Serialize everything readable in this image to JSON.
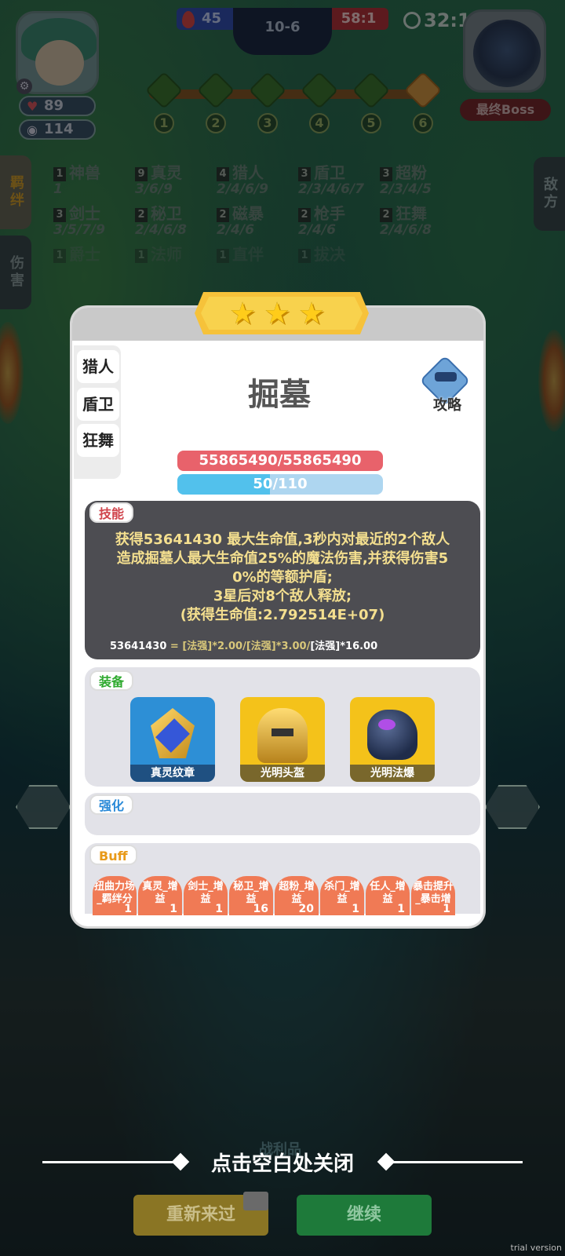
{
  "hud": {
    "blue_score": "45",
    "stage": "10-6",
    "red_score": "58:1",
    "timer": "32:1",
    "hp": "89",
    "coins": "114",
    "boss_label": "最终Boss",
    "nodes": [
      "1",
      "2",
      "3",
      "4",
      "5",
      "6"
    ]
  },
  "sidebar": {
    "tab_synergy": "羁绊",
    "tab_damage": "伤害",
    "tab_enemy": "敌方"
  },
  "synergies": [
    {
      "count": "1",
      "name": "神兽",
      "levels": "1"
    },
    {
      "count": "9",
      "name": "真灵",
      "levels": "3/6/9"
    },
    {
      "count": "4",
      "name": "猎人",
      "levels": "2/4/6/9"
    },
    {
      "count": "3",
      "name": "盾卫",
      "levels": "2/3/4/6/7"
    },
    {
      "count": "3",
      "name": "超粉",
      "levels": "2/3/4/5"
    },
    {
      "count": "3",
      "name": "剑士",
      "levels": "3/5/7/9"
    },
    {
      "count": "2",
      "name": "秘卫",
      "levels": "2/4/6/8"
    },
    {
      "count": "2",
      "name": "磁暴",
      "levels": "2/4/6"
    },
    {
      "count": "2",
      "name": "枪手",
      "levels": "2/4/6"
    },
    {
      "count": "2",
      "name": "狂舞",
      "levels": "2/4/6/8"
    },
    {
      "count": "1",
      "name": "爵士",
      "levels": ""
    },
    {
      "count": "1",
      "name": "法师",
      "levels": ""
    },
    {
      "count": "1",
      "name": "直伴",
      "levels": ""
    },
    {
      "count": "1",
      "name": "拔决",
      "levels": ""
    }
  ],
  "card": {
    "hero_tags": [
      "猎人",
      "盾卫",
      "狂舞"
    ],
    "hero_name": "掘墓",
    "guide_label": "攻略",
    "hp_text": "55865490/55865490",
    "mana_text": "50/110",
    "mana_fraction": 0.45,
    "skill_label": "技能",
    "skill_lines": [
      "获得53641430 最大生命值,3秒内对最近的2个敌人",
      "造成掘墓人最大生命值25%的魔法伤害,并获得伤害5",
      "0%的等额护盾;",
      "3星后对8个敌人释放;",
      "(获得生命值:2.792514E+07)"
    ],
    "skill_formula_value": "53641430",
    "skill_formula_rest": "= [法强]*2.00/[法强]*3.00/",
    "skill_formula_end": "[法强]*16.00",
    "equip_label": "装备",
    "equipment": [
      {
        "name": "真灵纹章",
        "color": "#2d8fd6"
      },
      {
        "name": "光明头盔",
        "color": "#f4c21a"
      },
      {
        "name": "光明法爆",
        "color": "#f4c21a"
      }
    ],
    "enhance_label": "强化",
    "buff_label": "Buff",
    "buffs": [
      {
        "name": "扭曲力场_羁绊分",
        "count": "1"
      },
      {
        "name": "真灵_增益",
        "count": "1"
      },
      {
        "name": "剑士_增益",
        "count": "1"
      },
      {
        "name": "秘卫_增益",
        "count": "16"
      },
      {
        "name": "超粉_增益",
        "count": "20"
      },
      {
        "name": "杀门_增益",
        "count": "1"
      },
      {
        "name": "任人_增益",
        "count": "1"
      },
      {
        "name": "暴击提升_暴击增",
        "count": "1"
      }
    ]
  },
  "footer": {
    "close_hint": "点击空白处关闭",
    "loot_label": "战利品",
    "retry_label": "重新来过",
    "continue_label": "继续",
    "trial": "trial version"
  }
}
